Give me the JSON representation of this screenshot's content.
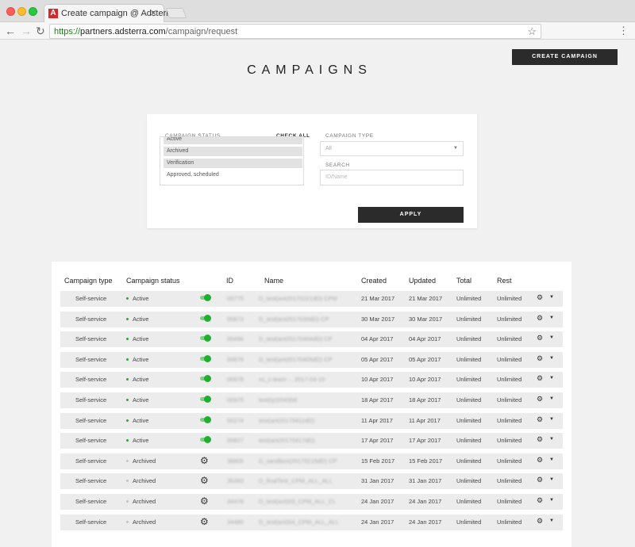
{
  "browser": {
    "tab_title": "Create campaign @ Adsterra",
    "tab_favicon": "A",
    "tab_close": "✕",
    "url_proto": "https://",
    "url_host": "partners.adsterra.com",
    "url_path": "/campaign/request",
    "icons": [
      "back-arrow-icon",
      "forward-arrow-icon",
      "reload-icon",
      "star-icon",
      "menu-dots-icon"
    ]
  },
  "page": {
    "title": "CAMPAIGNS",
    "create_button": "CREATE CAMPAIGN"
  },
  "filters": {
    "status_label": "CAMPAIGN STATUS",
    "check_all": "CHECK ALL",
    "status_options": [
      "Active",
      "Archived",
      "Verification",
      "Approved, scheduled"
    ],
    "type_label": "CAMPAIGN TYPE",
    "type_value": "All",
    "search_label": "SEARCH",
    "search_placeholder": "ID/Name",
    "apply_button": "APPLY"
  },
  "table": {
    "headers": {
      "type": "Campaign type",
      "status": "Campaign status",
      "id": "ID",
      "name": "Name",
      "created": "Created",
      "updated": "Updated",
      "total": "Total",
      "rest": "Rest"
    },
    "rows": [
      {
        "type": "Self-service",
        "status": "Active",
        "id": "00775",
        "name": "D_test(ant20170221dD) CPM",
        "created": "21 Mar 2017",
        "updated": "21 Mar 2017",
        "total": "Unlimited",
        "rest": "Unlimited"
      },
      {
        "type": "Self-service",
        "status": "Active",
        "id": "00873",
        "name": "D_test(ant2017030dD) CP",
        "created": "30 Mar 2017",
        "updated": "30 Mar 2017",
        "total": "Unlimited",
        "rest": "Unlimited"
      },
      {
        "type": "Self-service",
        "status": "Active",
        "id": "00496",
        "name": "D_test(ant20170404dD) CP",
        "created": "04 Apr 2017",
        "updated": "04 Apr 2017",
        "total": "Unlimited",
        "rest": "Unlimited"
      },
      {
        "type": "Self-service",
        "status": "Active",
        "id": "00878",
        "name": "D_test(ant20170405dD) CP",
        "created": "05 Apr 2017",
        "updated": "05 Apr 2017",
        "total": "Unlimited",
        "rest": "Unlimited"
      },
      {
        "type": "Self-service",
        "status": "Active",
        "id": "00978",
        "name": "ss_c-team ... 2017-04-10",
        "created": "10 Apr 2017",
        "updated": "10 Apr 2017",
        "total": "Unlimited",
        "rest": "Unlimited"
      },
      {
        "type": "Self-service",
        "status": "Active",
        "id": "00975",
        "name": "test(ty)20430d",
        "created": "18 Apr 2017",
        "updated": "18 Apr 2017",
        "total": "Unlimited",
        "rest": "Unlimited"
      },
      {
        "type": "Self-service",
        "status": "Active",
        "id": "00274",
        "name": "test(ant20170411dD)",
        "created": "11 Apr 2017",
        "updated": "11 Apr 2017",
        "total": "Unlimited",
        "rest": "Unlimited"
      },
      {
        "type": "Self-service",
        "status": "Active",
        "id": "00827",
        "name": "test(ant20170417dD)",
        "created": "17 Apr 2017",
        "updated": "17 Apr 2017",
        "total": "Unlimited",
        "rest": "Unlimited"
      },
      {
        "type": "Self-service",
        "status": "Archived",
        "id": "38805",
        "name": "D_sandbox(20170215dD) CP",
        "created": "15 Feb 2017",
        "updated": "15 Feb 2017",
        "total": "Unlimited",
        "rest": "Unlimited"
      },
      {
        "type": "Self-service",
        "status": "Archived",
        "id": "35393",
        "name": "D_finalTest_CPM_ALL_ALL",
        "created": "31 Jan 2017",
        "updated": "31 Jan 2017",
        "total": "Unlimited",
        "rest": "Unlimited"
      },
      {
        "type": "Self-service",
        "status": "Archived",
        "id": "34478",
        "name": "D_test(ant)03_CPM_ALL_CL",
        "created": "24 Jan 2017",
        "updated": "24 Jan 2017",
        "total": "Unlimited",
        "rest": "Unlimited"
      },
      {
        "type": "Self-service",
        "status": "Archived",
        "id": "34480",
        "name": "D_test(ant)04_CPM_ALL_ALL",
        "created": "24 Jan 2017",
        "updated": "24 Jan 2017",
        "total": "Unlimited",
        "rest": "Unlimited"
      }
    ]
  },
  "colors": {
    "active_dot": "#1fb02e",
    "archived_dot": "#c4c4c4",
    "button_bg": "#2b2b2b"
  }
}
